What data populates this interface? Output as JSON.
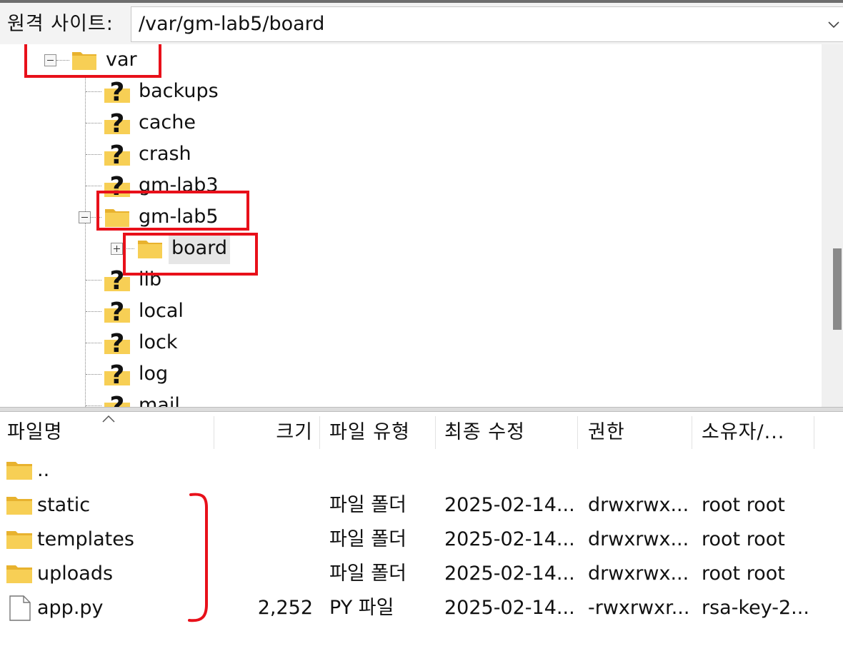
{
  "address_bar": {
    "label": "원격 사이트:",
    "path": "/var/gm-lab5/board"
  },
  "tree": {
    "items": [
      {
        "label": "var",
        "icon": "folder-icon",
        "expander": "minus"
      },
      {
        "label": "backups",
        "icon": "unknown-folder-icon"
      },
      {
        "label": "cache",
        "icon": "unknown-folder-icon"
      },
      {
        "label": "crash",
        "icon": "unknown-folder-icon"
      },
      {
        "label": "gm-lab3",
        "icon": "unknown-folder-icon"
      },
      {
        "label": "gm-lab5",
        "icon": "folder-icon",
        "expander": "minus"
      },
      {
        "label": "board",
        "icon": "folder-icon",
        "expander": "plus",
        "selected": true
      },
      {
        "label": "lib",
        "icon": "unknown-folder-icon"
      },
      {
        "label": "local",
        "icon": "unknown-folder-icon"
      },
      {
        "label": "lock",
        "icon": "unknown-folder-icon"
      },
      {
        "label": "log",
        "icon": "unknown-folder-icon"
      },
      {
        "label": "mail",
        "icon": "unknown-folder-icon"
      }
    ]
  },
  "file_list": {
    "columns": [
      "파일명",
      "크기",
      "파일 유형",
      "최종 수정",
      "권한",
      "소유자/..."
    ],
    "rows": [
      {
        "name": "..",
        "size": "",
        "type": "",
        "modified": "",
        "permissions": "",
        "owner": "",
        "icon": "folder-icon"
      },
      {
        "name": "static",
        "size": "",
        "type": "파일 폴더",
        "modified": "2025-02-14...",
        "permissions": "drwxrwx...",
        "owner": "root root",
        "icon": "folder-icon"
      },
      {
        "name": "templates",
        "size": "",
        "type": "파일 폴더",
        "modified": "2025-02-14...",
        "permissions": "drwxrwx...",
        "owner": "root root",
        "icon": "folder-icon"
      },
      {
        "name": "uploads",
        "size": "",
        "type": "파일 폴더",
        "modified": "2025-02-14...",
        "permissions": "drwxrwx...",
        "owner": "root root",
        "icon": "folder-icon"
      },
      {
        "name": "app.py",
        "size": "2,252",
        "type": "PY 파일",
        "modified": "2025-02-14...",
        "permissions": "-rwxrwxr...",
        "owner": "rsa-key-2...",
        "icon": "file-icon"
      }
    ]
  },
  "colors": {
    "annotation": "#e8101a",
    "folder": "#f5c542",
    "selection": "#e6e6e6"
  }
}
